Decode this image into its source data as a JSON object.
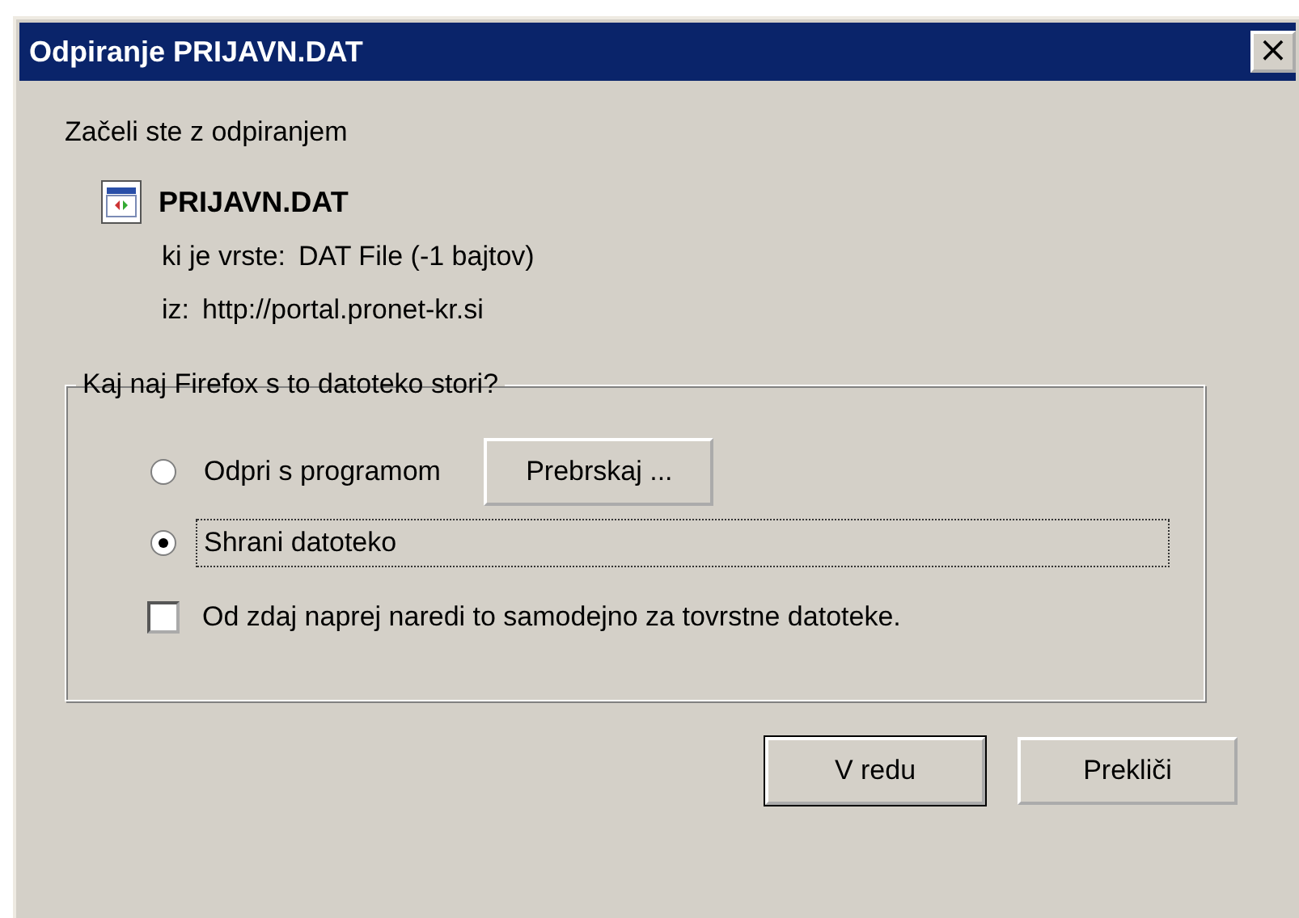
{
  "window": {
    "title": "Odpiranje PRIJAVN.DAT",
    "close": "×"
  },
  "intro": "Začeli ste z odpiranjem",
  "file": {
    "name": "PRIJAVN.DAT",
    "type_label": "ki je vrste:",
    "type_value": "DAT File (-1 bajtov)",
    "from_label": "iz:",
    "from_value": "http://portal.pronet-kr.si"
  },
  "group": {
    "legend": "Kaj naj Firefox s to datoteko stori?",
    "options": [
      {
        "label": "Odpri s programom",
        "selected": false,
        "focused": false,
        "button": "Prebrskaj ..."
      },
      {
        "label": "Shrani datoteko",
        "selected": true,
        "focused": true
      }
    ],
    "remember": {
      "label": "Od zdaj naprej naredi to samodejno za tovrstne datoteke.",
      "checked": false
    }
  },
  "buttons": [
    {
      "label": "V redu",
      "default": true
    },
    {
      "label": "Prekliči",
      "default": false
    }
  ]
}
